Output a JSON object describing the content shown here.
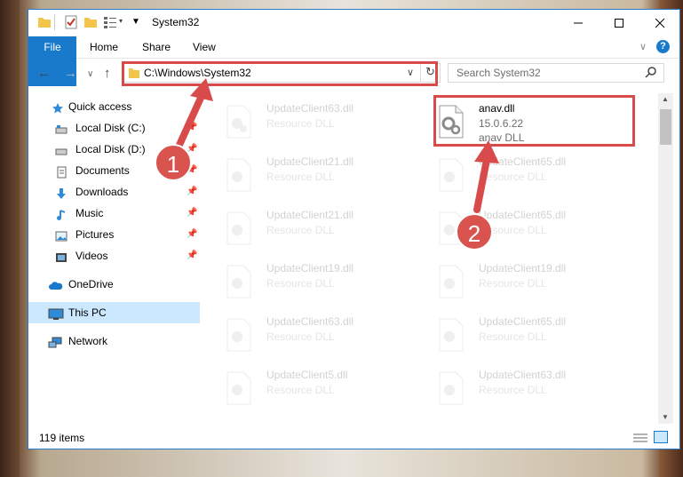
{
  "window": {
    "title": "System32"
  },
  "ribbon": {
    "tabs": [
      "File",
      "Home",
      "Share",
      "View"
    ]
  },
  "address": {
    "path": "C:\\Windows\\System32"
  },
  "search": {
    "placeholder": "Search System32"
  },
  "nav": {
    "items": [
      {
        "label": "Quick access",
        "icon": "star-icon",
        "pinned": false
      },
      {
        "label": "Local Disk (C:)",
        "icon": "drive-icon",
        "pinned": true
      },
      {
        "label": "Local Disk (D:)",
        "icon": "drive-icon",
        "pinned": true
      },
      {
        "label": "Documents",
        "icon": "documents-icon",
        "pinned": true
      },
      {
        "label": "Downloads",
        "icon": "download-icon",
        "pinned": true
      },
      {
        "label": "Music",
        "icon": "music-icon",
        "pinned": true
      },
      {
        "label": "Pictures",
        "icon": "pictures-icon",
        "pinned": true
      },
      {
        "label": "Videos",
        "icon": "videos-icon",
        "pinned": true
      },
      {
        "label": "OneDrive",
        "icon": "cloud-icon",
        "pinned": false
      },
      {
        "label": "This PC",
        "icon": "computer-icon",
        "pinned": false,
        "selected": true
      },
      {
        "label": "Network",
        "icon": "network-icon",
        "pinned": false
      }
    ]
  },
  "files": [
    {
      "name": "UpdateClient63.dll",
      "sub1": "Resource DLL",
      "sub2": "",
      "faded": true
    },
    {
      "name": "anav.dll",
      "sub1": "15.0.6.22",
      "sub2": "anav DLL",
      "faded": false
    },
    {
      "name": "UpdateClient21.dll",
      "sub1": "Resource DLL",
      "sub2": "",
      "faded": true
    },
    {
      "name": "UpdateClient65.dll",
      "sub1": "Resource DLL",
      "sub2": "",
      "faded": true
    },
    {
      "name": "UpdateClient21.dll",
      "sub1": "Resource DLL",
      "sub2": "",
      "faded": true
    },
    {
      "name": "UpdateClient65.dll",
      "sub1": "Resource DLL",
      "sub2": "",
      "faded": true
    },
    {
      "name": "UpdateClient19.dll",
      "sub1": "Resource DLL",
      "sub2": "",
      "faded": true
    },
    {
      "name": "UpdateClient19.dll",
      "sub1": "Resource DLL",
      "sub2": "",
      "faded": true
    },
    {
      "name": "UpdateClient63.dll",
      "sub1": "Resource DLL",
      "sub2": "",
      "faded": true
    },
    {
      "name": "UpdateClient65.dll",
      "sub1": "Resource DLL",
      "sub2": "",
      "faded": true
    },
    {
      "name": "UpdateClient5.dll",
      "sub1": "Resource DLL",
      "sub2": "",
      "faded": true
    },
    {
      "name": "UpdateClient63.dll",
      "sub1": "Resource DLL",
      "sub2": "",
      "faded": true
    }
  ],
  "status": {
    "item_count": "119 items"
  },
  "annotations": {
    "step1": "1",
    "step2": "2",
    "color": "#d94a4a"
  }
}
